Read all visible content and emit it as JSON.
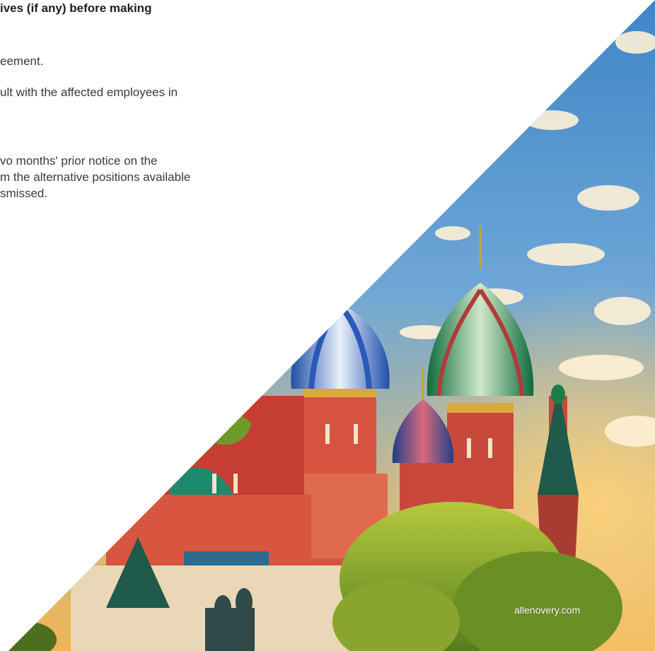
{
  "document": {
    "heading_fragment": "ives (if any) before making",
    "lines": [
      "eement.",
      "ult with the affected employees in",
      "vo months' prior notice on the",
      "m the alternative positions available",
      "smissed."
    ]
  },
  "photo": {
    "subject": "cathedral-domes-photo",
    "caption": "allenovery.com"
  }
}
